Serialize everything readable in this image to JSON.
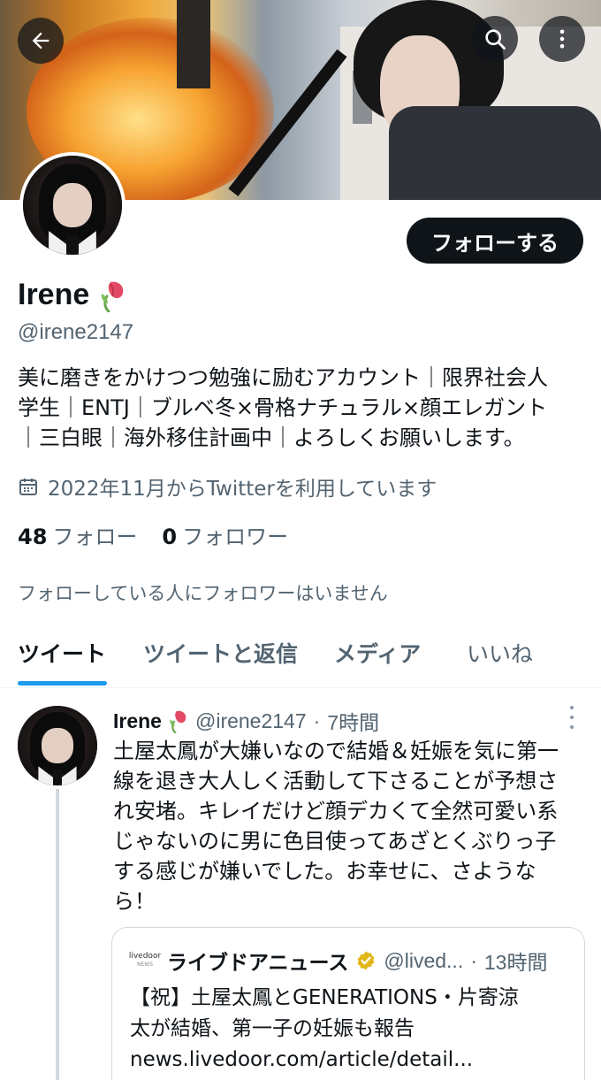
{
  "profile": {
    "display_name": "Irene",
    "handle": "@irene2147",
    "follow_button": "フォローする",
    "bio_lines": [
      "美に磨きをかけつつ勉強に励むアカウント｜限界社会人",
      "学生｜ENTJ｜ブルベ冬×骨格ナチュラル×顔エレガント",
      "｜三白眼｜海外移住計画中｜よろしくお願いします。"
    ],
    "joined": "2022年11月からTwitterを利用しています",
    "following_count": "48",
    "following_label": "フォロー",
    "followers_count": "0",
    "followers_label": "フォロワー",
    "no_mutual_followers": "フォローしている人にフォロワーはいません",
    "name_emoji": "wilted-tulip"
  },
  "tabs": [
    {
      "label": "ツイート",
      "active": true
    },
    {
      "label": "ツイートと返信",
      "active": false
    },
    {
      "label": "メディア",
      "active": false
    },
    {
      "label": "いいね",
      "active": false
    }
  ],
  "tweet": {
    "author": "Irene",
    "handle": "@irene2147",
    "separator": "·",
    "time": "7時間",
    "text_lines": [
      "土屋太鳳が大嫌いなので結婚＆妊娠を気に第一",
      "線を退き大人しく活動して下さることが予想さ",
      "れ安堵。キレイだけど顔デカくて全然可愛い系",
      "じゃないのに男に色目使ってあざとくぶりっ子",
      "する感じが嫌いでした。お幸せに、さような",
      "ら！"
    ],
    "quote": {
      "logo_text": "livedoor",
      "logo_sub": "NEWS",
      "author": "ライブドアニュース",
      "handle": "@lived...",
      "separator": "·",
      "time": "13時間",
      "text_lines": [
        "【祝】土屋太鳳とGENERATIONS・片寄涼",
        "太が結婚、第一子の妊娠も報告",
        "news.livedoor.com/article/detail..."
      ]
    }
  },
  "colors": {
    "accent": "#1d9bf0",
    "text_primary": "#0f1419",
    "text_secondary": "#536471",
    "verified_gold": "#e2b719"
  },
  "icons": [
    "back-arrow-icon",
    "search-icon",
    "more-vertical-icon",
    "calendar-icon",
    "tulip-emoji-icon",
    "verified-badge-icon"
  ]
}
